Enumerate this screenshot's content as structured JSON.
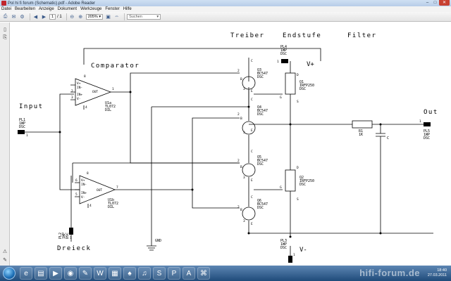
{
  "window": {
    "title": "Pol hi fi forum (Schematic).pdf - Adobe Reader",
    "controls": {
      "minimize": "–",
      "maximize": "□",
      "close": "✕"
    }
  },
  "menu": [
    "Datei",
    "Bearbeiten",
    "Anzeige",
    "Dokument",
    "Werkzeuge",
    "Fenster",
    "Hilfe"
  ],
  "toolbar": {
    "page_current": "1",
    "page_total": "/ 1",
    "zoom": "205%",
    "search_placeholder": "Suchen"
  },
  "schematic": {
    "header_labels": [
      "Treiber",
      "Endstufe",
      "Filter"
    ],
    "comparator_label": "Comparator",
    "input_label": "Input",
    "output_label": "Out",
    "triangle_label": "Dreieck",
    "vplus_label": "V+",
    "vminus_label": "V-",
    "gnd_label": "GND",
    "u1a": {
      "name": "U1a",
      "part": "TL072",
      "pkg": "DIL",
      "pin_plus": "V+",
      "pin_in_minus": "IN-",
      "pin_in_plus": "IN+",
      "pin_vminus": "V-",
      "out": "OUT",
      "pins": [
        "8",
        "2",
        "3",
        "4",
        "1"
      ]
    },
    "u1b": {
      "name": "U1b",
      "part": "TL072",
      "pkg": "DIL",
      "pin_plus": "V+",
      "pin_in_minus": "IN-",
      "pin_in_plus": "IN+",
      "pin_vminus": "V-",
      "out": "OUT",
      "pins": [
        "8",
        "6",
        "5",
        "4",
        "7"
      ]
    },
    "pl1": {
      "name": "PL1",
      "type": "1WP",
      "pkg": "DSC",
      "pin": "1"
    },
    "pl2": {
      "name": "PL2",
      "type": "1WP",
      "pkg": "DSC",
      "pin": "1"
    },
    "pl3": {
      "name": "PL3",
      "type": "1WP",
      "pkg": "DSC",
      "pin": "1"
    },
    "pl4": {
      "name": "PL4",
      "type": "1WP",
      "pkg": "DSC",
      "pin": "1"
    },
    "pl5": {
      "name": "PL5",
      "type": "1WP",
      "pkg": "DSC",
      "pin": "1"
    },
    "q1": {
      "name": "Q1",
      "part": "IRFP250",
      "pkg": "DSC"
    },
    "q2": {
      "name": "Q2",
      "part": "IRFP250",
      "pkg": "DSC"
    },
    "q3": {
      "name": "Q3",
      "part": "BC547",
      "pkg": "DSC"
    },
    "q4": {
      "name": "Q4",
      "part": "BC547",
      "pkg": "DSC"
    },
    "q5": {
      "name": "Q5",
      "part": "BC547",
      "pkg": "DSC"
    },
    "q6": {
      "name": "Q6",
      "part": "BC547",
      "pkg": "DSC"
    },
    "r1": {
      "name": "R1",
      "value": "1K"
    },
    "c1": {
      "name": "C"
    },
    "pin_c": "C",
    "pin_b": "B",
    "pin_e": "E",
    "pin_d": "D",
    "pin_g": "G",
    "pin_s": "S",
    "num_1": "1",
    "num_2": "2",
    "num_3": "3"
  },
  "taskbar": {
    "apps": [
      "ie-icon",
      "folder-icon",
      "media-icon",
      "firefox-icon",
      "paint-icon",
      "word-icon",
      "pc-icon",
      "game-icon",
      "itunes-icon",
      "skype-icon",
      "ps-icon",
      "acrobat-icon",
      "network-icon"
    ],
    "time": "18:40",
    "date": "27.03.2011",
    "watermark": "hifi-forum.de"
  }
}
